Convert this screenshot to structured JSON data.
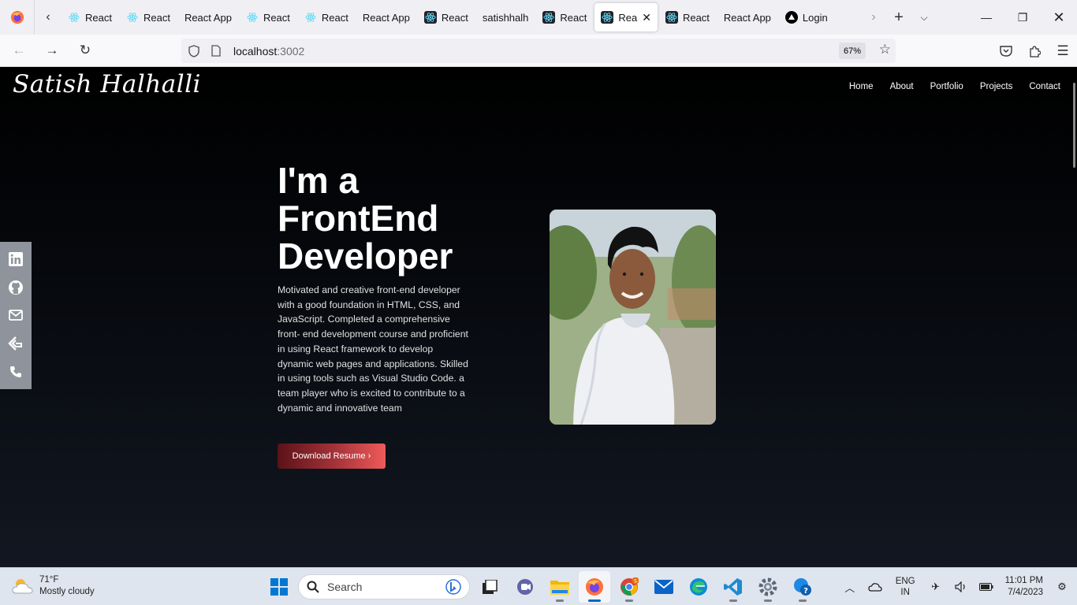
{
  "browser": {
    "tabs": [
      {
        "title": "React",
        "icon": "react-icon"
      },
      {
        "title": "React",
        "icon": "react-icon"
      },
      {
        "title": "React App",
        "icon": "none"
      },
      {
        "title": "React",
        "icon": "react-icon"
      },
      {
        "title": "React",
        "icon": "react-icon"
      },
      {
        "title": "React App",
        "icon": "none"
      },
      {
        "title": "React",
        "icon": "react-dark-icon"
      },
      {
        "title": "satishhalh",
        "icon": "none"
      },
      {
        "title": "React",
        "icon": "react-dark-icon"
      },
      {
        "title": "Rea",
        "icon": "react-dark-icon",
        "active": true
      },
      {
        "title": "React",
        "icon": "react-dark-icon"
      },
      {
        "title": "React App",
        "icon": "none"
      },
      {
        "title": "Login",
        "icon": "vercel-icon"
      }
    ],
    "url_host": "localhost",
    "url_port": ":3002",
    "zoom": "67%"
  },
  "site": {
    "brand": "Satish Halhalli",
    "nav": [
      "Home",
      "About",
      "Portfolio",
      "Projects",
      "Contact"
    ],
    "headline": "I'm a FrontEnd Developer",
    "bio": "Motivated and creative front-end developer with a good foundation in HTML, CSS, and JavaScript. Completed a comprehensive front- end development course and proficient in using React framework to develop dynamic web pages and applications. Skilled in using tools such as Visual Studio Code. a team player who is excited to contribute to a dynamic and innovative team",
    "button": "Download Resume ›",
    "social": [
      "linkedin-icon",
      "github-icon",
      "mail-icon",
      "resume-icon",
      "phone-icon"
    ]
  },
  "taskbar": {
    "temp": "71°F",
    "weather": "Mostly cloudy",
    "search_placeholder": "Search",
    "lang_1": "ENG",
    "lang_2": "IN",
    "time": "11:01 PM",
    "date": "7/4/2023"
  }
}
